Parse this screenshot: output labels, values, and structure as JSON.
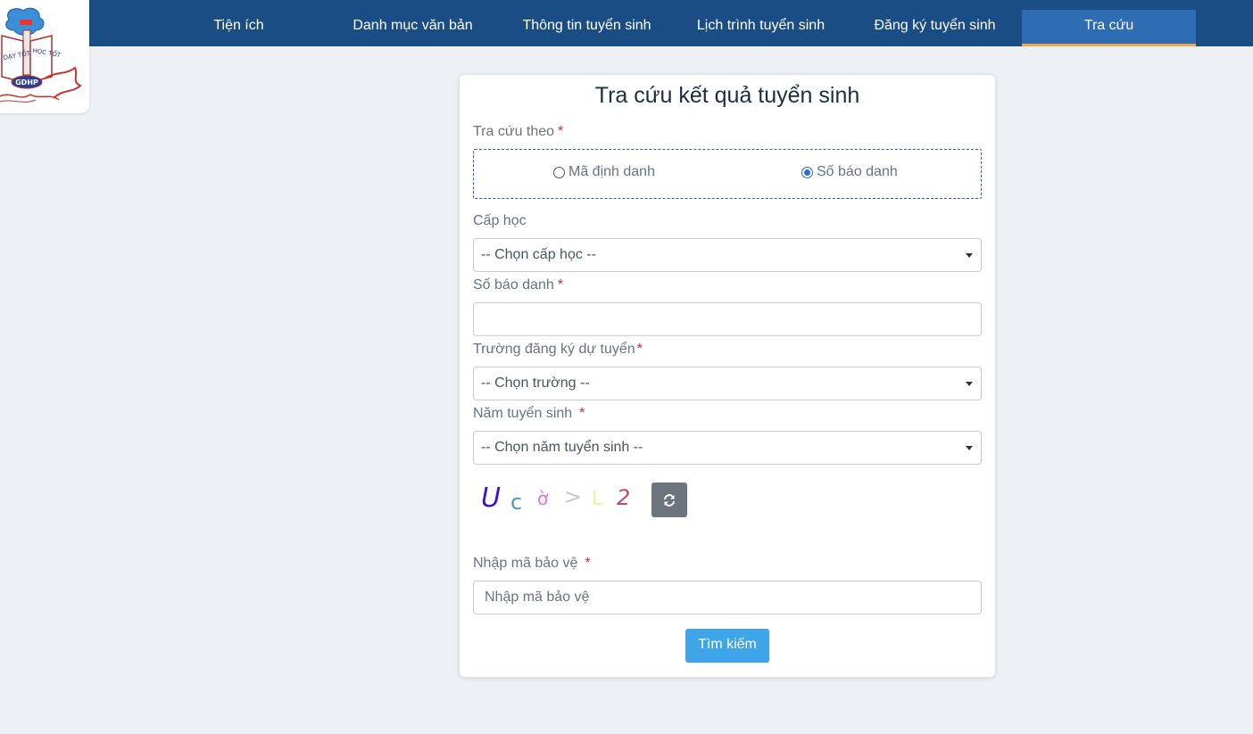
{
  "nav": {
    "items": [
      {
        "label": "Tiện ích"
      },
      {
        "label": "Danh mục văn bản"
      },
      {
        "label": "Thông tin tuyển sinh"
      },
      {
        "label": "Lịch trình tuyển sinh"
      },
      {
        "label": "Đăng ký tuyển sinh"
      },
      {
        "label": "Tra cứu",
        "active": true
      }
    ]
  },
  "logo": {
    "left_text": "DẠY TỐT",
    "right_text": "HỌC TỐT",
    "badge": "GDHP"
  },
  "form": {
    "title": "Tra cứu kết quả tuyển sinh",
    "lookup_by_label": "Tra cứu theo",
    "radio_options": [
      {
        "label": "Mã định danh",
        "checked": false
      },
      {
        "label": "Số báo danh",
        "checked": true
      }
    ],
    "level_label": "Cấp học",
    "level_value": "-- Chọn cấp học --",
    "sbd_label": "Số báo danh",
    "sbd_value": "",
    "school_label": "Trường đăng ký dự tuyển",
    "school_value": "-- Chọn trường --",
    "year_label": "Năm tuyển sinh",
    "year_value": "-- Chọn năm tuyển sinh --",
    "captcha_chars": [
      "U",
      "c",
      "ờ",
      ">",
      "L",
      "2"
    ],
    "captcha_label": "Nhập mã bảo vệ",
    "captcha_placeholder": "Nhập mã bảo vệ",
    "required_mark": "*",
    "search_label": "Tìm kiếm"
  },
  "colors": {
    "nav_bg": "#1b4d85",
    "nav_active": "#2e6db4",
    "nav_active_underline": "#f0a948",
    "primary_button": "#3ea6e8",
    "refresh_button": "#6c757d"
  }
}
